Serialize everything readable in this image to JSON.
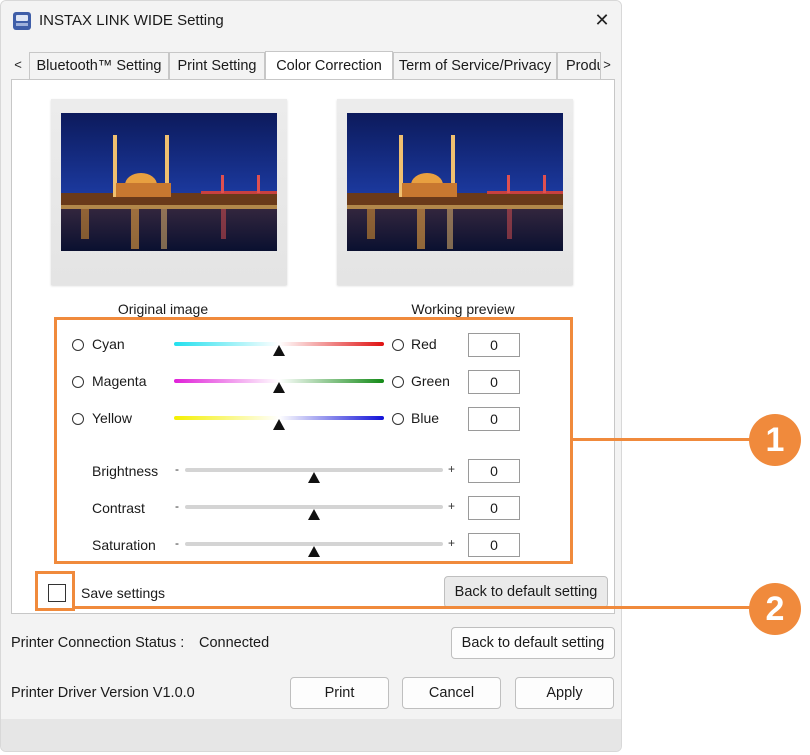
{
  "window": {
    "title": "INSTAX LINK WIDE Setting",
    "close_symbol": "✕"
  },
  "tabs": {
    "prev_arrow": "<",
    "next_arrow": ">",
    "items": [
      {
        "label": "Bluetooth™ Setting",
        "active": false
      },
      {
        "label": "Print Setting",
        "active": false
      },
      {
        "label": "Color Correction",
        "active": true
      },
      {
        "label": "Term of Service/Privacy",
        "active": false
      },
      {
        "label": "Produ",
        "active": false
      }
    ]
  },
  "previews": {
    "original_caption": "Original image",
    "working_caption": "Working preview"
  },
  "color_balance": [
    {
      "left_label": "Cyan",
      "left_color": "#22e0ee",
      "right_label": "Red",
      "right_color": "#e01010",
      "value": "0",
      "level": 0.5
    },
    {
      "left_label": "Magenta",
      "left_color": "#e020d8",
      "right_label": "Green",
      "right_color": "#138a16",
      "value": "0",
      "level": 0.5
    },
    {
      "left_label": "Yellow",
      "left_color": "#f4f000",
      "right_label": "Blue",
      "right_color": "#1010d8",
      "value": "0",
      "level": 0.5
    }
  ],
  "adjustments": [
    {
      "label": "Brightness",
      "minus": "-",
      "plus": "+",
      "value": "0",
      "level": 0.5
    },
    {
      "label": "Contrast",
      "minus": "-",
      "plus": "+",
      "value": "0",
      "level": 0.5
    },
    {
      "label": "Saturation",
      "minus": "-",
      "plus": "+",
      "value": "0",
      "level": 0.5
    }
  ],
  "panel_footer": {
    "save_settings_label": "Save settings",
    "save_settings_checked": false,
    "back_default_label": "Back to default setting"
  },
  "footer": {
    "connection_label": "Printer Connection Status :",
    "connection_value": "Connected",
    "back_default_label": "Back to default setting",
    "driver_version": "Printer Driver Version V1.0.0",
    "print_label": "Print",
    "cancel_label": "Cancel",
    "apply_label": "Apply"
  },
  "callouts": {
    "badge1": "1",
    "badge2": "2",
    "accent_color": "#f08a3c"
  }
}
